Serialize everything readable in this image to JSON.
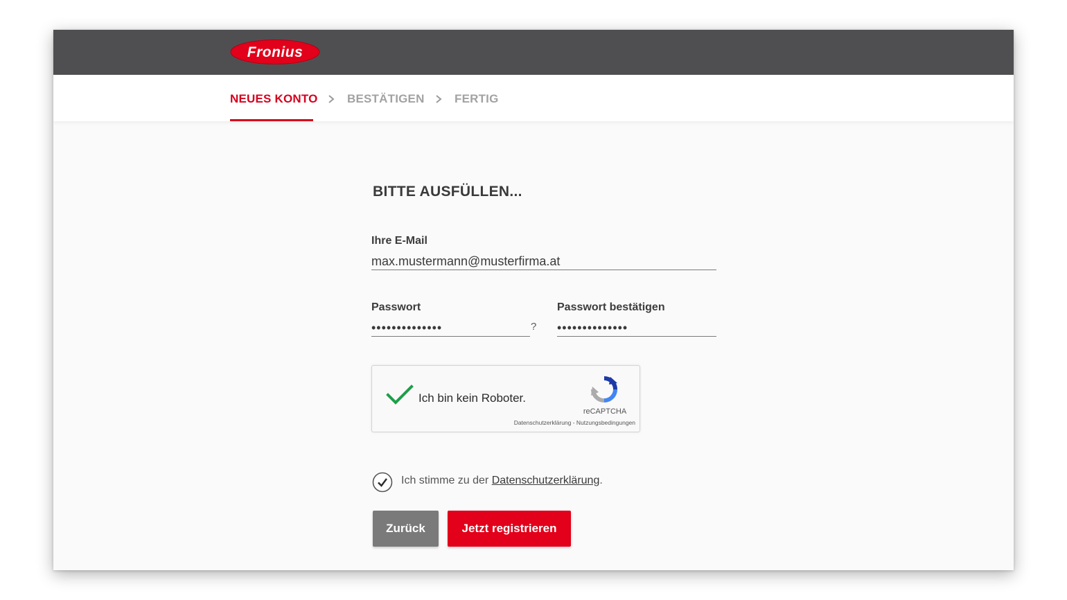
{
  "header": {
    "logo_text": "Fronius",
    "brand_color": "#e2001a",
    "bar_color": "#4f4f51"
  },
  "steps": [
    {
      "label": "NEUES KONTO",
      "active": true
    },
    {
      "label": "BESTÄTIGEN",
      "active": false
    },
    {
      "label": "FERTIG",
      "active": false
    }
  ],
  "form": {
    "title": "BITTE AUSFÜLLEN...",
    "email": {
      "label": "Ihre E-Mail",
      "value": "max.mustermann@musterfirma.at"
    },
    "password": {
      "label": "Passwort",
      "value": "••••••••••••••",
      "help": "?"
    },
    "password_confirm": {
      "label": "Passwort bestätigen",
      "value": "••••••••••••••"
    }
  },
  "captcha": {
    "label": "Ich bin kein Roboter.",
    "brand": "reCAPTCHA",
    "links": "Datenschutzerklärung - Nutzungsbedingungen",
    "checked": true
  },
  "consent": {
    "prefix": "Ich stimme zu der ",
    "link": "Datenschutzerklärung",
    "suffix": ".",
    "checked": true
  },
  "buttons": {
    "back": "Zurück",
    "register": "Jetzt registrieren"
  },
  "colors": {
    "accent": "#d5001d",
    "inactive_step": "#a2a2a2",
    "back_button": "#7a7a7a",
    "captcha_check": "#1e9e4a"
  }
}
